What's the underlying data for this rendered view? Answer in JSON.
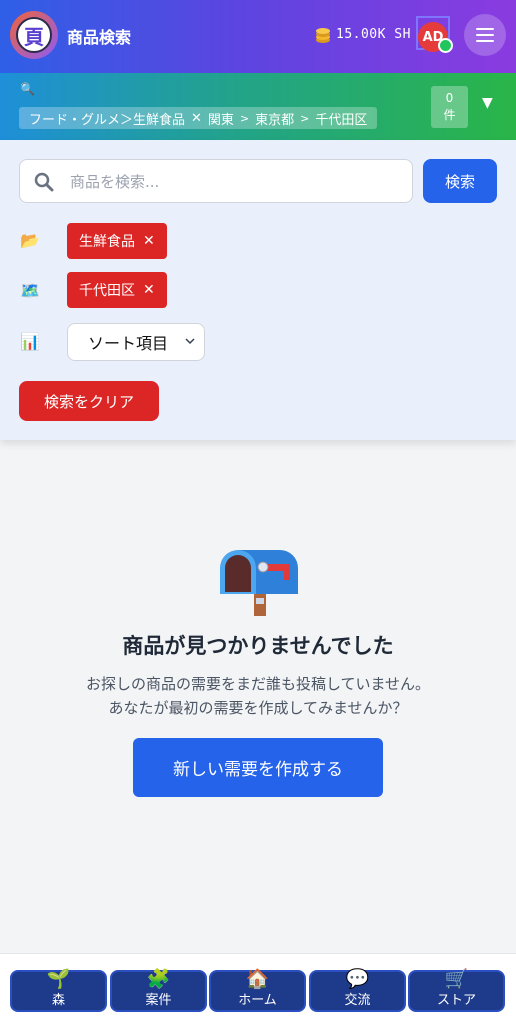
{
  "header": {
    "logo_text": "頁",
    "title": "商品検索",
    "balance": "15.00K SH",
    "avatar_initials": "AD",
    "coin_icon": "coin-stack-icon",
    "menu_icon": "hamburger-icon"
  },
  "filter_bar": {
    "search_icon": "🔍",
    "breadcrumb": {
      "category": "フード・グルメ＞生鮮食品",
      "remove": "✕",
      "region": "関東",
      "sep": ">",
      "prefecture": "東京都",
      "city": "千代田区"
    },
    "count_value": "0",
    "count_unit": "件",
    "toggle": "▼"
  },
  "search": {
    "placeholder": "商品を検索...",
    "value": "",
    "button_label": "検索"
  },
  "filters": {
    "category_icon": "📂",
    "category_chip": "生鮮食品",
    "region_icon": "🗺️",
    "region_chip": "千代田区",
    "sort_icon": "📊",
    "chip_remove": "✕",
    "sort_label": "ソート項目",
    "clear_button": "検索をクリア"
  },
  "empty_state": {
    "icon": "mailbox-icon",
    "title": "商品が見つかりませんでした",
    "line1": "お探しの商品の需要をまだ誰も投稿していません。",
    "line2": "あなたが最初の需要を作成してみませんか？",
    "button_label": "新しい需要を作成する"
  },
  "bottom_nav": [
    {
      "icon": "🌱",
      "label": "森"
    },
    {
      "icon": "🧩",
      "label": "案件"
    },
    {
      "icon": "🏠",
      "label": "ホーム"
    },
    {
      "icon": "💬",
      "label": "交流"
    },
    {
      "icon": "🛒",
      "label": "ストア"
    }
  ],
  "colors": {
    "primary": "#2563eb",
    "danger": "#dc2626",
    "nav": "#1e3a8a"
  }
}
